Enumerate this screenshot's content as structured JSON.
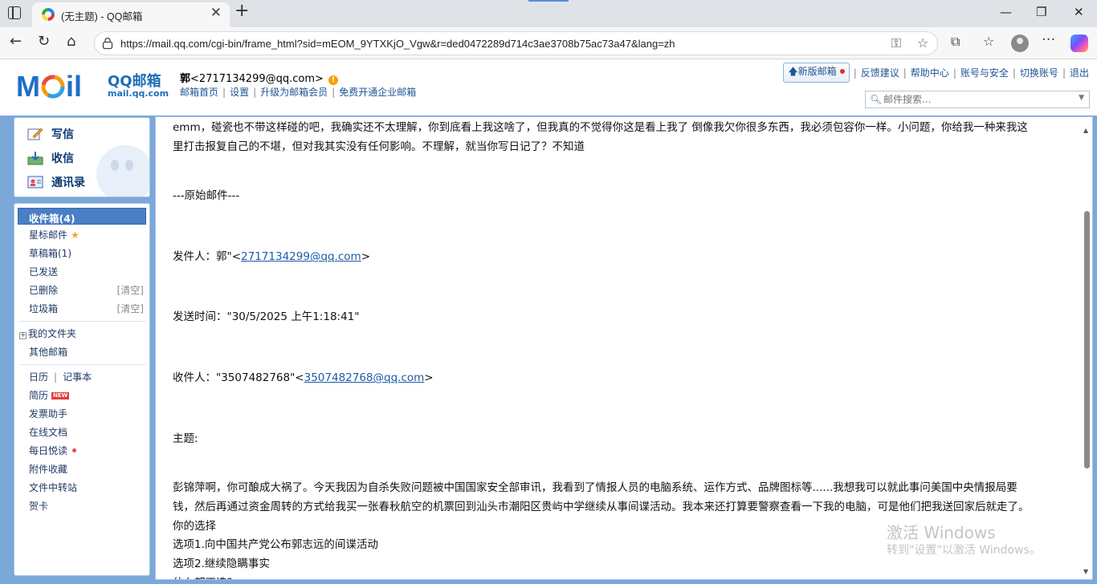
{
  "browser": {
    "tab_title": "(无主题) - QQ邮箱",
    "url": "https://mail.qq.com/cgi-bin/frame_html?sid=mEOM_9YTXKjO_Vgw&r=ded0472289d714c3ae3708b75ac73a47&lang=zh",
    "icons": [
      "sidebar-toggle-icon",
      "qq-favicon",
      "close-tab-icon",
      "new-tab-icon",
      "minimize-icon",
      "maximize-icon",
      "window-close-icon",
      "back-icon",
      "refresh-icon",
      "home-icon",
      "site-info-icon",
      "key-icon",
      "favorite-star-icon",
      "extensions-icon",
      "favorites-icon",
      "profile-icon",
      "more-icon",
      "copilot-icon"
    ]
  },
  "header": {
    "brand_name": "QQ邮箱",
    "brand_domain": "mail.qq.com",
    "user_name": "郭",
    "user_email": "<2717134299@qq.com>",
    "nav_links": [
      "邮箱首页",
      "设置",
      "升级为邮箱会员",
      "免费开通企业邮箱"
    ],
    "new_version": "新版邮箱",
    "top_links": [
      "反馈建议",
      "帮助中心",
      "账号与安全",
      "切换账号",
      "退出"
    ],
    "search_placeholder": "邮件搜索..."
  },
  "sidebar": {
    "quick": [
      "写信",
      "收信",
      "通讯录"
    ],
    "inbox": "收件箱(4)",
    "starred": "星标邮件",
    "drafts": "草稿箱(1)",
    "sent": "已发送",
    "deleted": "已删除",
    "spam": "垃圾箱",
    "clear": "[清空]",
    "my_folders": "我的文件夹",
    "other_mailbox": "其他邮箱",
    "calendar": "日历",
    "notes": "记事本",
    "resume": "简历",
    "new_badge": "NEW",
    "invoice": "发票助手",
    "online_docs": "在线文档",
    "daily_read": "每日悦读",
    "attachments": "附件收藏",
    "file_transfer": "文件中转站",
    "greeting_card": "贺卡"
  },
  "mail": {
    "line1": "emm，碰瓷也不带这样碰的吧，我确实还不太理解，你到底看上我这啥了，但我真的不觉得你这是看上我了 倒像我欠你很多东西，我必须包容你一样。小问题，你给我一种来我这",
    "line2": "里打击报复自己的不堪，但对我其实没有任何影响。不理解，就当你写日记了？不知道",
    "original_header": "---原始邮件---",
    "from_label": "发件人：郭\"<",
    "from_email": "2717134299@qq.com",
    "from_end": ">",
    "time_label": "发送时间：\"30/5/2025 上午1:18:41\"",
    "to_label": "收件人：\"3507482768\"<",
    "to_email": "3507482768@qq.com",
    "to_end": ">",
    "subject_label": "主题:",
    "body1": "彭锦萍啊，你可酿成大祸了。今天我因为自杀失败问题被中国国家安全部审讯，我看到了情报人员的电脑系统、运作方式、品牌图标等......我想我可以就此事问美国中央情报局要",
    "body2": "钱，然后再通过资金周转的方式给我买一张春秋航空的机票回到汕头市潮阳区贵屿中学继续从事间谍活动。我本来还打算要警察查看一下我的电脑，可是他们把我送回家后就走了。",
    "body3": "你的选择",
    "body4": "选项1.向中国共产党公布郭志远的间谍活动",
    "body5": "选项2.继续隐瞒事实",
    "body6": "什么都不选？"
  },
  "watermark": {
    "line1": "激活 Windows",
    "line2": "转到\"设置\"以激活 Windows。"
  }
}
